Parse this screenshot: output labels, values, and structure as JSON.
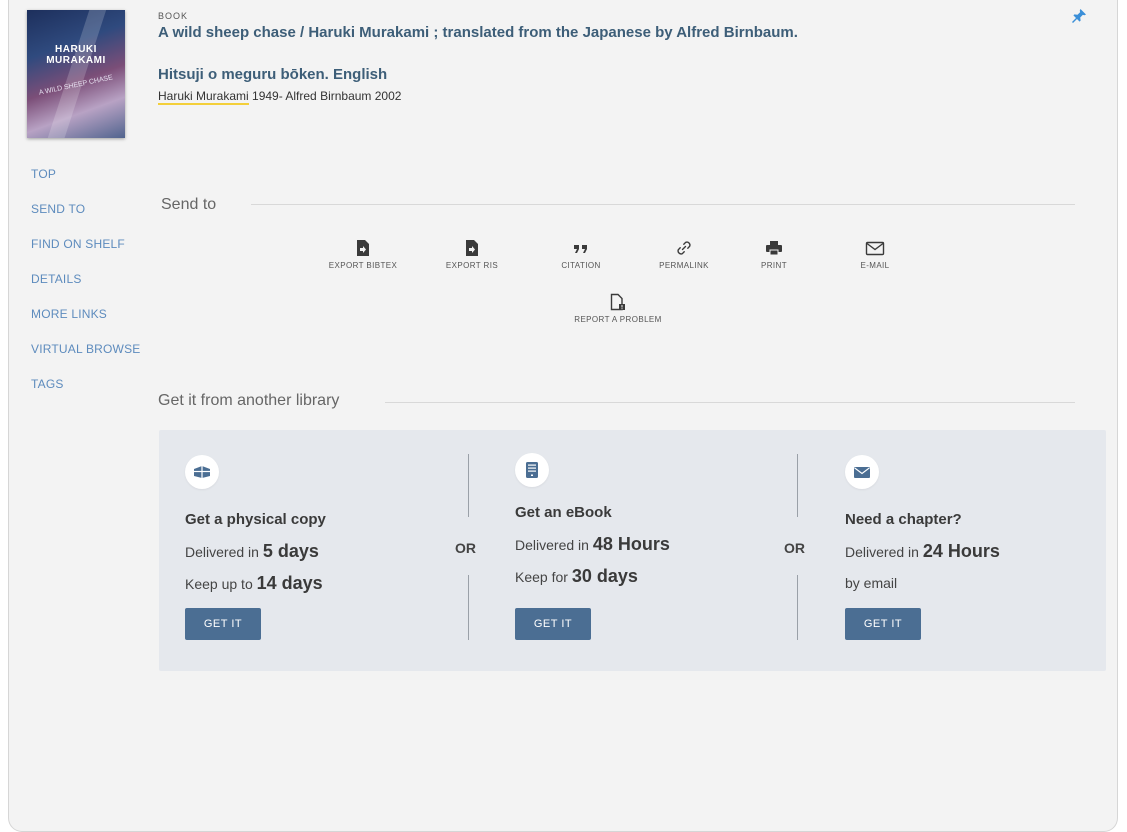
{
  "record": {
    "type": "BOOK",
    "title": "A wild sheep chase / Haruki Murakami ; translated from the Japanese by Alfred Birnbaum.",
    "alt_title": "Hitsuji o meguru bōken. English",
    "author_main": "Haruki Murakami",
    "author_rest": " 1949- Alfred Birnbaum 2002"
  },
  "cover": {
    "line1": "HARUKI",
    "line2": "MURAKAMI",
    "line3": "A WILD SHEEP CHASE"
  },
  "nav": [
    "TOP",
    "SEND TO",
    "FIND ON SHELF",
    "DETAILS",
    "MORE LINKS",
    "VIRTUAL BROWSE",
    "TAGS"
  ],
  "send_to": {
    "title": "Send to",
    "actions": [
      {
        "label": "EXPORT BIBTEX",
        "icon": "export-file-icon"
      },
      {
        "label": "EXPORT RIS",
        "icon": "export-file-icon"
      },
      {
        "label": "CITATION",
        "icon": "quote-icon"
      },
      {
        "label": "PERMALINK",
        "icon": "link-icon"
      },
      {
        "label": "PRINT",
        "icon": "printer-icon"
      },
      {
        "label": "E-MAIL",
        "icon": "envelope-icon"
      }
    ],
    "report": {
      "label": "REPORT A PROBLEM",
      "icon": "report-problem-icon"
    }
  },
  "get_it": {
    "title": "Get it from another library",
    "or_label": "OR",
    "options": [
      {
        "heading": "Get a physical copy",
        "line1_prefix": "Delivered in ",
        "line1_value": "5 days",
        "line2_prefix": "Keep up to ",
        "line2_value": "14 days",
        "button": "GET IT"
      },
      {
        "heading": "Get an eBook",
        "line1_prefix": "Delivered in ",
        "line1_value": "48 Hours",
        "line2_prefix": "Keep for ",
        "line2_value": "30 days",
        "button": "GET IT"
      },
      {
        "heading": "Need a chapter?",
        "line1_prefix": "Delivered in ",
        "line1_value": "24 Hours",
        "line2_prefix": "by email",
        "line2_value": "",
        "button": "GET IT"
      }
    ]
  },
  "colors": {
    "accent": "#5d8bbd",
    "title": "#3d5e78",
    "button": "#4b6e93",
    "highlight": "#f3cf3a"
  }
}
